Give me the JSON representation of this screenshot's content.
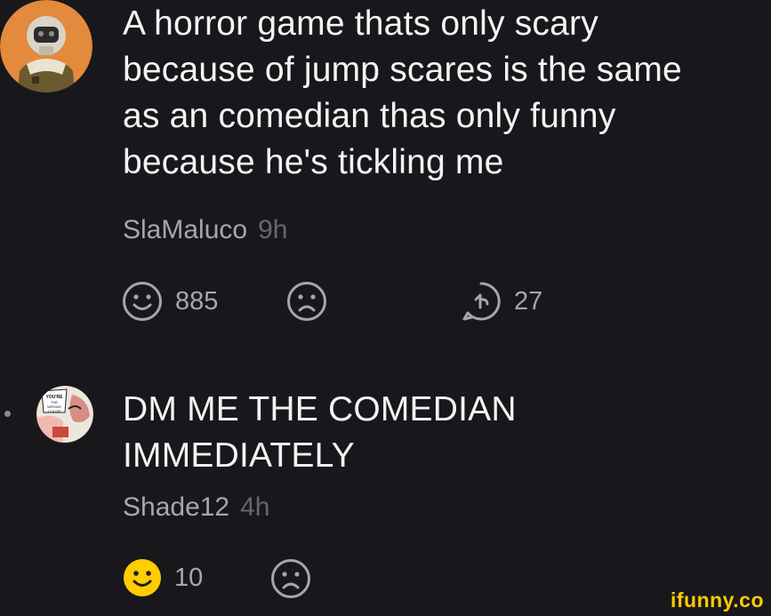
{
  "comments": [
    {
      "text_lines": [
        "A horror game thats only scary",
        "because of jump scares is the same",
        "as an comedian thas only funny",
        "because he's tickling me"
      ],
      "author": "SlaMaluco",
      "time": "9h",
      "smile_count": "885",
      "reply_count": "27",
      "avatar_icon": "astronaut-avatar-icon"
    },
    {
      "text_lines": [
        "DM ME THE COMEDIAN",
        "IMMEDIATELY"
      ],
      "author": "Shade12",
      "time": "4h",
      "smile_count": "10",
      "smile_active": true,
      "avatar_icon": "comic-avatar-icon",
      "avatar_caption": "YOU'RE THE WRONG COLOR"
    }
  ],
  "watermark": "ifunny.co",
  "colors": {
    "background": "#18181c",
    "text": "#f3f3f3",
    "muted": "#a6a6ab",
    "time": "#66666b",
    "active_smile": "#ffcc00"
  }
}
